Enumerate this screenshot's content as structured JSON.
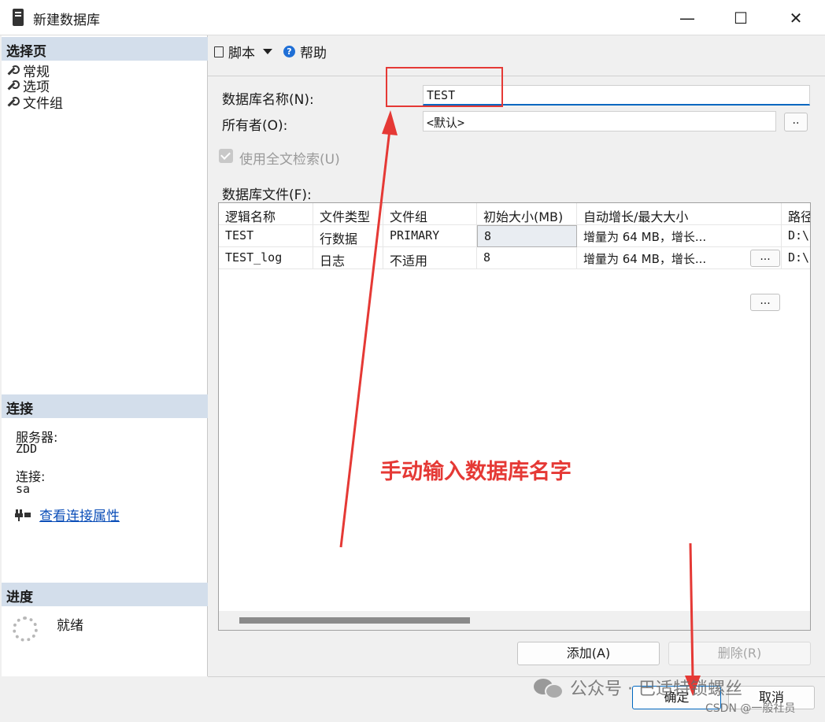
{
  "window": {
    "title": "新建数据库",
    "min_glyph": "—",
    "max_glyph": "☐",
    "close_glyph": "✕"
  },
  "sidebar": {
    "select_page_header": "选择页",
    "pages": [
      {
        "label": "常规",
        "icon": "wrench-icon"
      },
      {
        "label": "选项",
        "icon": "wrench-icon"
      },
      {
        "label": "文件组",
        "icon": "wrench-icon"
      }
    ],
    "connection_header": "连接",
    "server_label": "服务器:",
    "server_value": "ZDD",
    "connection_label": "连接:",
    "connection_value": "sa",
    "view_props_link": "查看连接属性",
    "progress_header": "进度",
    "progress_status": "就绪"
  },
  "toolbar": {
    "script_label": "脚本",
    "help_label": "帮助"
  },
  "form": {
    "db_name_label": "数据库名称(N):",
    "db_name_value": "TEST",
    "owner_label": "所有者(O):",
    "owner_value": "<默认>",
    "owner_browse": "..",
    "fulltext_label": "使用全文检索(U)",
    "fulltext_checked": true,
    "files_label": "数据库文件(F):"
  },
  "files_table": {
    "columns": [
      "逻辑名称",
      "文件类型",
      "文件组",
      "初始大小(MB)",
      "自动增长/最大大小",
      "路径"
    ],
    "rows": [
      {
        "logical": "TEST",
        "type": "行数据",
        "group": "PRIMARY",
        "size": "8",
        "growth": "增量为 64 MB，增长...",
        "browse": "...",
        "path": "D:\\S"
      },
      {
        "logical": "TEST_log",
        "type": "日志",
        "group": "不适用",
        "size": "8",
        "growth": "增量为 64 MB，增长...",
        "browse": "...",
        "path": "D:\\S"
      }
    ]
  },
  "buttons": {
    "add": "添加(A)",
    "remove": "删除(R)",
    "ok": "确定",
    "cancel": "取消"
  },
  "annotation": {
    "text": "手动输入数据库名字",
    "color": "#e53935"
  },
  "watermark": {
    "brand": "公众号 · 巴适特锁螺丝",
    "csdn": "CSDN @一般社员"
  }
}
